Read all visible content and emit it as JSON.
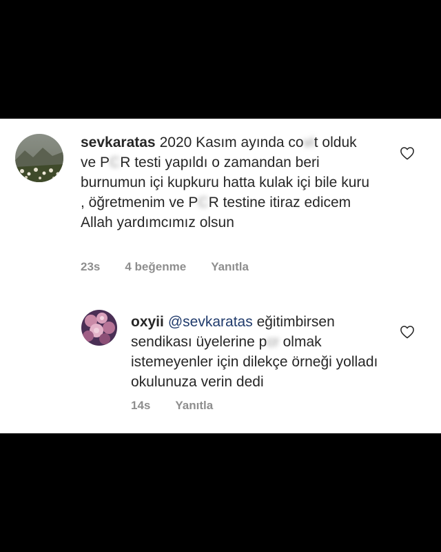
{
  "comments": [
    {
      "username": "sevkaratas",
      "segments": [
        {
          "t": "2020 Kasım ayında "
        },
        {
          "t": "co"
        },
        {
          "t": "vi",
          "blur": true
        },
        {
          "t": "t olduk ve "
        },
        {
          "t": "P"
        },
        {
          "t": "C",
          "blur": true
        },
        {
          "t": "R testi yapıldı o zamandan beri burnumun içi kupkuru hatta kulak içi bile kuru , öğretmenim ve "
        },
        {
          "t": "P"
        },
        {
          "t": "C",
          "blur": true
        },
        {
          "t": "R testine itiraz edicem Allah yardımcımız olsun"
        }
      ],
      "time": "23s",
      "likes": "4 beğenme",
      "reply_label": "Yanıtla",
      "like_icon": "heart-outline-icon"
    },
    {
      "username": "oxyii",
      "mention": "@sevkaratas",
      "segments": [
        {
          "t": " eğitimbirsen sendikası üyelerine "
        },
        {
          "t": "p"
        },
        {
          "t": "cr",
          "blur": true
        },
        {
          "t": " olmak istemeyenler için dilekçe örneği yolladı okulunuza verin dedi"
        }
      ],
      "time": "14s",
      "reply_label": "Yanıtla",
      "like_icon": "heart-outline-icon"
    }
  ],
  "colors": {
    "background": "#000000",
    "panel": "#ffffff",
    "text": "#262626",
    "meta": "#8e8e8e",
    "mention": "#1f3a6b"
  }
}
